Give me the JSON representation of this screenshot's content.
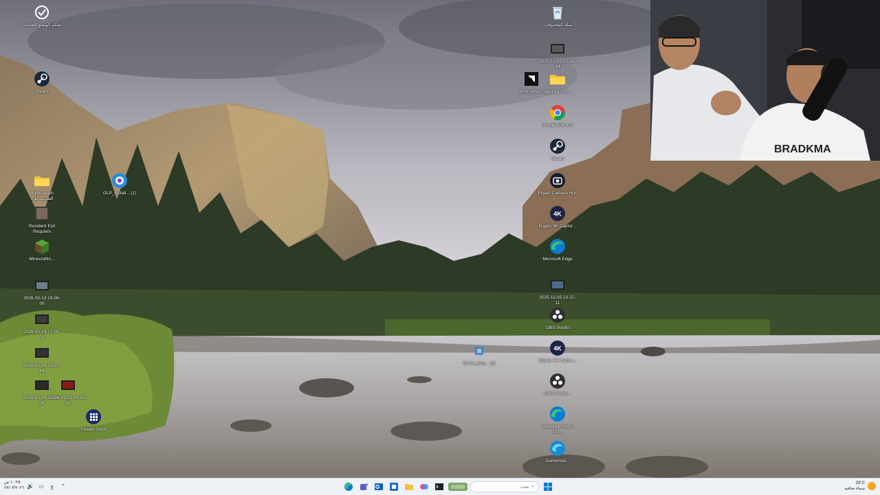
{
  "desktop": {
    "left_icons": [
      {
        "id": "pc-health",
        "label": "تحكم الويندو التحديث",
        "icon": "settings-circle-icon"
      },
      {
        "id": "steam-left",
        "label": "Steam",
        "icon": "steam-icon"
      },
      {
        "id": "bully",
        "label": "Bully steam ...التعريب لو",
        "icon": "folder-icon"
      },
      {
        "id": "glp",
        "label": "GLP_install... (1)",
        "icon": "installer-icon"
      },
      {
        "id": "re",
        "label": "Resident Evil Requiem",
        "icon": "game-icon"
      },
      {
        "id": "minecraft",
        "label": "Minecraftin...",
        "icon": "minecraft-icon"
      },
      {
        "id": "vid1",
        "label": "2026-03-13 19-06-00",
        "icon": "video-file-icon"
      },
      {
        "id": "vid2",
        "label": "2026-03-14 17-09-09",
        "icon": "video-file-icon"
      },
      {
        "id": "vid3",
        "label": "2026-03-14 13-33-44",
        "icon": "video-file-icon"
      },
      {
        "id": "vid4",
        "label": "2026-03-14 10-44-08",
        "icon": "video-file-icon"
      },
      {
        "id": "vid5",
        "label": "2026-03-13 14-55-38",
        "icon": "video-file-icon"
      },
      {
        "id": "streamdeck",
        "label": "Stream Deck",
        "icon": "stream-deck-icon"
      }
    ],
    "right_icons": [
      {
        "id": "recycle",
        "label": "سلة المحذوفات",
        "icon": "recycle-bin-icon"
      },
      {
        "id": "vid6",
        "label": "2025-11-05 22-31-14",
        "icon": "video-file-icon"
      },
      {
        "id": "amd",
        "label": "amd_amd...",
        "icon": "amd-icon"
      },
      {
        "id": "sand",
        "label": "Sand Ag..sho...",
        "icon": "folder-icon"
      },
      {
        "id": "chrome",
        "label": "Google Chrome",
        "icon": "chrome-icon"
      },
      {
        "id": "steam-right",
        "label": "Steam",
        "icon": "steam-icon"
      },
      {
        "id": "elgato-cam",
        "label": "Elgato Camera Hub",
        "icon": "camera-hub-icon"
      },
      {
        "id": "elgato-4k-1",
        "label": "Elgato 4K Captur...",
        "icon": "elgato-4k-icon"
      },
      {
        "id": "edge",
        "label": "Microsoft Edge",
        "icon": "edge-icon"
      },
      {
        "id": "vid7",
        "label": "2025-11-05 23-37-11",
        "icon": "video-file-icon"
      },
      {
        "id": "obs1",
        "label": "OBS Studio",
        "icon": "obs-icon"
      },
      {
        "id": "game-exe",
        "label": "Game_Exp... (1)",
        "icon": "game-shortcut-icon"
      },
      {
        "id": "elgato-4k-2",
        "label": "Elgato 4K Captur...",
        "icon": "elgato-4k-icon"
      },
      {
        "id": "obs2",
        "label": "OBS Studio...",
        "icon": "obs-icon"
      },
      {
        "id": "dl-amd",
        "label": "Download AMD Sof...",
        "icon": "edge-icon"
      },
      {
        "id": "gamebar",
        "label": "GameHub...",
        "icon": "edge-blue-icon"
      }
    ]
  },
  "taskbar": {
    "clock_time": "١٠:٣٥ ص",
    "clock_date": "٢٧/٠٣/٢٠٢٦",
    "lang": "ع",
    "search_placeholder": "بحث",
    "weather_temp": "29°C",
    "weather_desc": "سماء صافية",
    "apps": [
      "edge-icon",
      "teams-icon",
      "outlook-icon",
      "store-icon",
      "explorer-icon",
      "copilot-icon",
      "terminal-icon"
    ]
  },
  "colors": {
    "taskbar_bg": "#eef1f5",
    "accent": "#0078d4"
  }
}
